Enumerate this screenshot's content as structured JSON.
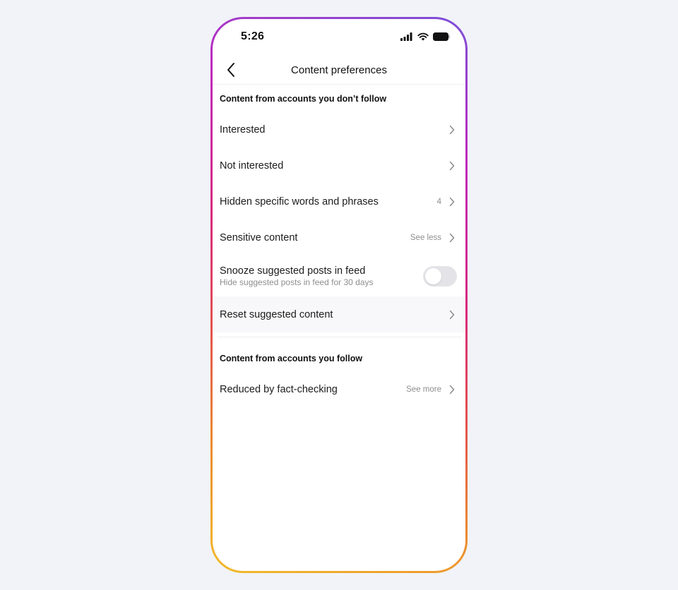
{
  "status_bar": {
    "time": "5:26",
    "icons": [
      "signal-icon",
      "wifi-icon",
      "battery-icon"
    ]
  },
  "header": {
    "back_icon": "chevron-left-icon",
    "title": "Content preferences"
  },
  "sections": [
    {
      "title": "Content from accounts you don’t follow",
      "rows": [
        {
          "label": "Interested",
          "value": ""
        },
        {
          "label": "Not interested",
          "value": ""
        },
        {
          "label": "Hidden specific words and phrases",
          "value": "4"
        },
        {
          "label": "Sensitive content",
          "value": "See less"
        }
      ],
      "toggle_row": {
        "label": "Snooze suggested posts in feed",
        "sublabel": "Hide suggested posts in feed for 30 days",
        "on": false
      },
      "reset_row": {
        "label": "Reset suggested content",
        "value": ""
      }
    },
    {
      "title": "Content from accounts you follow",
      "rows": [
        {
          "label": "Reduced by fact-checking",
          "value": "See more"
        }
      ]
    }
  ],
  "colors": {
    "background": "#f1f3f8",
    "frame_gradient": [
      "#7b4fd8",
      "#c02abd",
      "#d92a7c",
      "#e4514f",
      "#ec8a2f",
      "#f2bb2a"
    ],
    "toggle_off": "#e4e4e8"
  }
}
